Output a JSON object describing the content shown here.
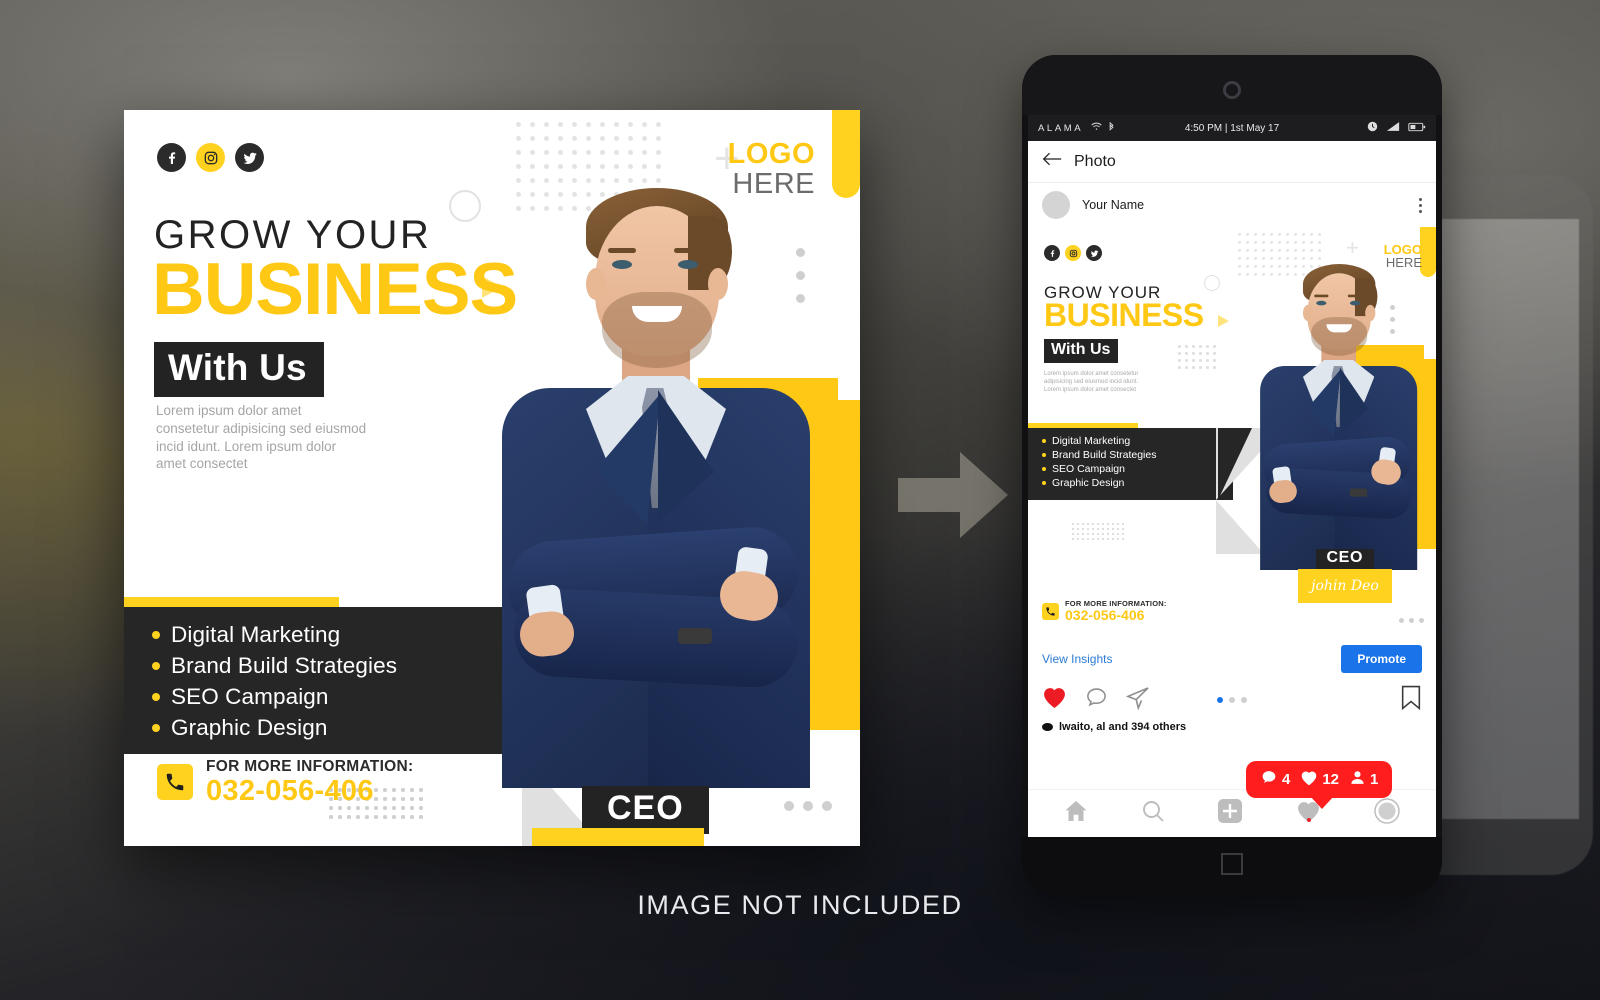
{
  "background": {
    "caption": "IMAGE NOT INCLUDED"
  },
  "poster": {
    "socials": [
      {
        "name": "facebook-icon",
        "glyph": "f"
      },
      {
        "name": "instagram-icon",
        "glyph": "ig"
      },
      {
        "name": "twitter-icon",
        "glyph": "t"
      }
    ],
    "logo": {
      "line1": "LOGO",
      "line2": "HERE"
    },
    "headline": {
      "line1": "GROW YOUR",
      "line2": "BUSINESS",
      "line3": "With Us"
    },
    "lorem": "Lorem ipsum dolor amet consetetur adipisicing sed eiusmod incid idunt. Lorem ipsum dolor amet consectet",
    "services": [
      "Digital Marketing",
      "Brand Build Strategies",
      "SEO Campaign",
      "Graphic Design"
    ],
    "contact": {
      "label": "FOR MORE INFORMATION:",
      "phone": "032-056-406",
      "icon": "phone-ringing-icon"
    },
    "person": {
      "role": "CEO",
      "name": "johin Deo"
    },
    "colors": {
      "yellow": "#FFD21F",
      "yellow_text": "#FFC814",
      "dark": "#262626",
      "grey": "#e0e0e0"
    }
  },
  "phone": {
    "statusbar": {
      "carrier": "ALAMA",
      "time": "4:50 PM | 1st May 17",
      "icons": [
        "wifi-icon",
        "bluetooth-icon",
        "alarm-icon",
        "signal-icon",
        "battery-icon"
      ]
    },
    "header": {
      "back": "back-arrow-icon",
      "title": "Photo"
    },
    "profile": {
      "username": "Your Name",
      "menu": "kebab-menu-icon"
    },
    "insights": {
      "link": "View Insights",
      "promote": "Promote"
    },
    "actions": {
      "like": "heart-icon",
      "comment": "comment-icon",
      "share": "share-icon",
      "save": "bookmark-icon"
    },
    "notification": {
      "comments": "4",
      "likes": "12",
      "follows": "1"
    },
    "likes_text": "lwaito, al   and 394 others",
    "bottom_nav": [
      "home-icon",
      "search-icon",
      "add-icon",
      "activity-icon",
      "profile-icon"
    ],
    "colors": {
      "promote_blue": "#1a73e8",
      "link_blue": "#2c7bd4",
      "notification_red": "#FF1D1D"
    }
  },
  "arrow": {
    "name": "right-arrow-icon"
  }
}
